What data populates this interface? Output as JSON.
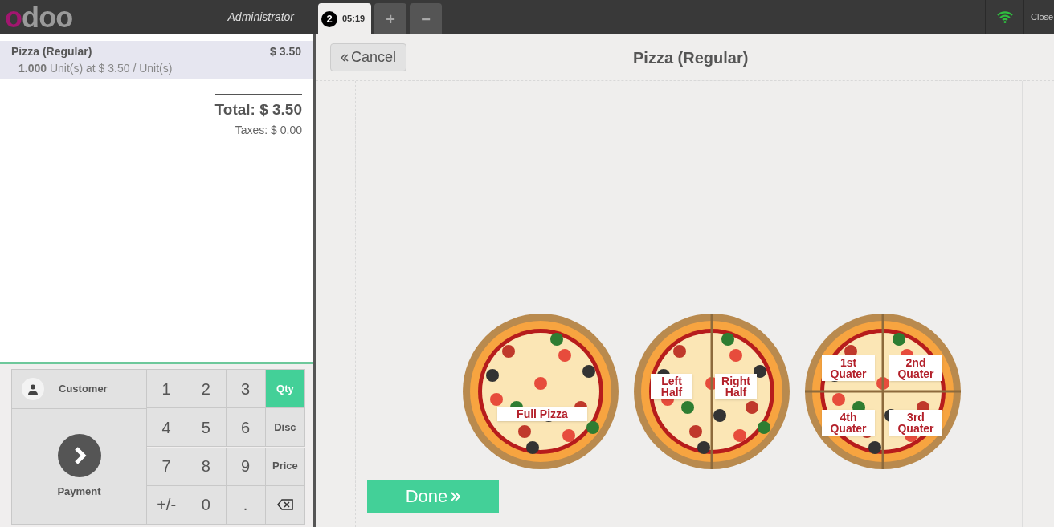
{
  "top_bar": {
    "logo": "odoo",
    "user": "Administrator",
    "order_tabs": [
      {
        "number": "2",
        "time": "05:19",
        "selected": true
      }
    ],
    "add_symbol": "+",
    "remove_symbol": "−",
    "close": "Close"
  },
  "order": {
    "lines": [
      {
        "name": "Pizza (Regular)",
        "price": "$ 3.50",
        "qty": "1.000",
        "detail": "Unit(s) at $ 3.50 / Unit(s)",
        "selected": true
      }
    ],
    "total": "Total: $ 3.50",
    "taxes": "Taxes: $ 0.00"
  },
  "pad": {
    "customer": "Customer",
    "payment": "Payment",
    "keys": [
      {
        "label": "1",
        "kind": "digit",
        "selected": false
      },
      {
        "label": "2",
        "kind": "digit",
        "selected": false
      },
      {
        "label": "3",
        "kind": "digit",
        "selected": false
      },
      {
        "label": "Qty",
        "kind": "mode",
        "selected": true
      },
      {
        "label": "4",
        "kind": "digit",
        "selected": false
      },
      {
        "label": "5",
        "kind": "digit",
        "selected": false
      },
      {
        "label": "6",
        "kind": "digit",
        "selected": false
      },
      {
        "label": "Disc",
        "kind": "mode",
        "selected": false
      },
      {
        "label": "7",
        "kind": "digit",
        "selected": false
      },
      {
        "label": "8",
        "kind": "digit",
        "selected": false
      },
      {
        "label": "9",
        "kind": "digit",
        "selected": false
      },
      {
        "label": "Price",
        "kind": "mode",
        "selected": false
      },
      {
        "label": "+/-",
        "kind": "digit",
        "selected": false
      },
      {
        "label": "0",
        "kind": "digit",
        "selected": false
      },
      {
        "label": ".",
        "kind": "digit",
        "selected": false
      },
      {
        "kind": "backspace",
        "selected": false
      }
    ]
  },
  "product": {
    "cancel": "Cancel",
    "title": "Pizza (Regular)",
    "options": [
      {
        "kind": "full",
        "labels": [
          "Full Pizza"
        ]
      },
      {
        "kind": "half",
        "labels": [
          "Left Half",
          "Right Half"
        ]
      },
      {
        "kind": "quarter",
        "labels": [
          "1st Quater",
          "2nd Quater",
          "4th Quater",
          "3rd Quater"
        ]
      }
    ],
    "done": "Done"
  }
}
